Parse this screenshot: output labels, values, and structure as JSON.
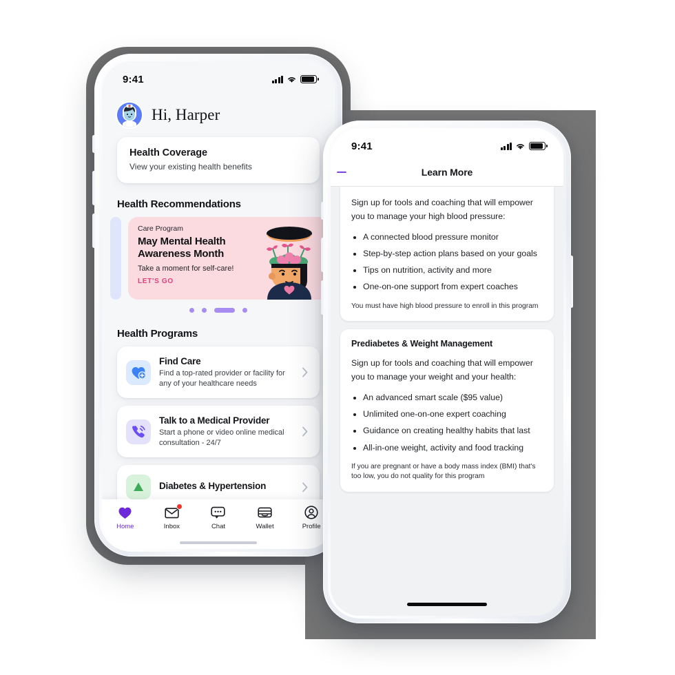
{
  "status_bar": {
    "time": "9:41",
    "signal_icon": "signal-bars-icon",
    "wifi_icon": "wifi-icon",
    "battery_icon": "battery-icon"
  },
  "left_phone": {
    "greeting": "Hi, Harper",
    "avatar_icon": "nurse-avatar-icon",
    "coverage_card": {
      "title": "Health Coverage",
      "subtitle": "View your existing health benefits"
    },
    "recommendations": {
      "section_title": "Health Recommendations",
      "promo": {
        "kicker": "Care Program",
        "title": "May Mental Health Awareness Month",
        "subtitle": "Take a moment for self-care!",
        "cta": "LET'S GO",
        "art_icon": "mental-health-illustration",
        "background": "#fbdbe0",
        "cta_color": "#e0407c"
      },
      "dots": [
        {
          "active": false
        },
        {
          "active": false
        },
        {
          "active": true
        },
        {
          "active": false
        }
      ],
      "dot_color": "#a98cf2"
    },
    "programs": {
      "section_title": "Health Programs",
      "items": [
        {
          "icon": "heart-plus-icon",
          "icon_tone": "blue",
          "title": "Find Care",
          "description": "Find a top-rated provider or facility for any of your healthcare needs"
        },
        {
          "icon": "phone-call-icon",
          "icon_tone": "purple",
          "title": "Talk to a Medical Provider",
          "description": "Start a phone or video online medical consultation - 24/7"
        },
        {
          "icon": "chart-up-icon",
          "icon_tone": "green",
          "title": "Diabetes & Hypertension",
          "description": ""
        }
      ]
    },
    "tab_bar": {
      "active_color": "#6d28d9",
      "items": [
        {
          "label": "Home",
          "icon": "heart-icon",
          "active": true,
          "badge": ""
        },
        {
          "label": "Inbox",
          "icon": "envelope-icon",
          "active": false,
          "badge": "dot"
        },
        {
          "label": "Chat",
          "icon": "chat-bubble-icon",
          "active": false,
          "badge": ""
        },
        {
          "label": "Wallet",
          "icon": "wallet-icon",
          "active": false,
          "badge": ""
        },
        {
          "label": "Profile",
          "icon": "person-circle-icon",
          "active": false,
          "badge": ""
        }
      ]
    }
  },
  "right_phone": {
    "nav_title": "Learn More",
    "back_icon": "back-arrow-icon",
    "cards": [
      {
        "heading": "",
        "lead": "Sign up for tools and coaching that will empower you to manage your high blood pressure:",
        "bullets": [
          "A connected blood pressure monitor",
          "Step-by-step action plans based on your goals",
          "Tips on nutrition, activity and more",
          "One-on-one support from expert coaches"
        ],
        "fineprint": "You must have high blood pressure to enroll in this program"
      },
      {
        "heading": "Prediabetes & Weight Management",
        "lead": "Sign up for tools and coaching that will empower you to manage your weight and your health:",
        "bullets": [
          "An advanced smart scale ($95 value)",
          "Unlimited one-on-one expert coaching",
          "Guidance on creating healthy habits that last",
          "All-in-one weight, activity and food tracking"
        ],
        "fineprint": "If you are pregnant or have a body mass index (BMI) that's too low, you do not quality for this program"
      }
    ]
  }
}
